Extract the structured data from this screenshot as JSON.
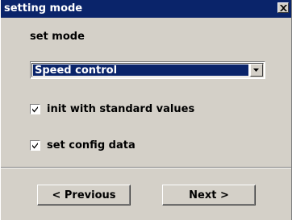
{
  "window": {
    "title": "setting mode",
    "close_icon": "close-x-icon"
  },
  "mode": {
    "label": "set mode",
    "selected": "Speed control",
    "dropdown_icon": "chevron-down-icon"
  },
  "options": {
    "init_standard": {
      "label": "init with standard values",
      "checked": true
    },
    "set_config": {
      "label": "set config data",
      "checked": true
    }
  },
  "buttons": {
    "previous": "< Previous",
    "next": "Next >"
  },
  "colors": {
    "titlebar": "#0a246a",
    "face": "#d4d0c8",
    "selection": "#0a246a"
  }
}
